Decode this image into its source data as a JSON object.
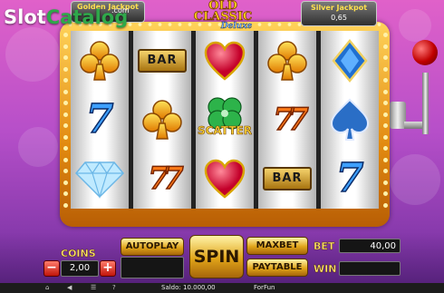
{
  "watermark": {
    "slot": "Slot",
    "catalog": "Catalog",
    "com": ".com"
  },
  "logo": {
    "line1": "OLD",
    "line2": "CLASSIC",
    "line3": "Deluxe"
  },
  "jackpots": {
    "golden": {
      "label": "Golden Jackpot",
      "value": ""
    },
    "silver": {
      "label": "Silver Jackpot",
      "value": "0,65"
    }
  },
  "reels": [
    [
      "clubs",
      "seven-blue",
      "diamond-gem"
    ],
    [
      "bar",
      "clubs",
      "seven-orange"
    ],
    [
      "heart",
      "scatter-clover",
      "heart"
    ],
    [
      "clubs",
      "seven-orange",
      "bar"
    ],
    [
      "diamond-gem-blue",
      "spade",
      "seven-blue"
    ]
  ],
  "symbols": {
    "bar_text": "BAR",
    "scatter_text": "SCATTER"
  },
  "controls": {
    "coins_label": "COINS",
    "coins_value": "2,00",
    "minus": "−",
    "plus": "+",
    "autoplay": "AUTOPLAY",
    "spin": "SPIN",
    "maxbet": "MAXBET",
    "paytable": "PAYTABLE",
    "bet_label": "BET",
    "bet_value": "40,00",
    "win_label": "WIN",
    "win_value": ""
  },
  "status": {
    "saldo": "Saldo: 10.000,00",
    "mode": "ForFun"
  },
  "colors": {
    "accent_gold": "#e0a419",
    "bg_pink": "#e061c9",
    "bg_purple": "#6c2d9b"
  }
}
